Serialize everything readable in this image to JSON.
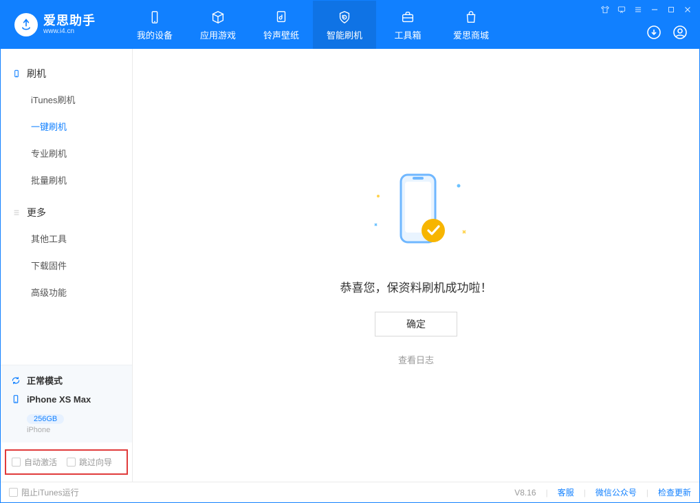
{
  "header": {
    "app_title": "爱思助手",
    "app_subtitle": "www.i4.cn",
    "nav": [
      "我的设备",
      "应用游戏",
      "铃声壁纸",
      "智能刷机",
      "工具箱",
      "爱思商城"
    ]
  },
  "sidebar": {
    "group1": {
      "label": "刷机",
      "items": [
        "iTunes刷机",
        "一键刷机",
        "专业刷机",
        "批量刷机"
      ]
    },
    "group2": {
      "label": "更多",
      "items": [
        "其他工具",
        "下载固件",
        "高级功能"
      ]
    }
  },
  "device": {
    "mode": "正常模式",
    "name": "iPhone XS Max",
    "storage": "256GB",
    "type": "iPhone"
  },
  "options": {
    "auto_activate": "自动激活",
    "skip_guide": "跳过向导"
  },
  "main": {
    "message": "恭喜您，保资料刷机成功啦！",
    "ok_button": "确定",
    "view_log": "查看日志"
  },
  "footer": {
    "block_itunes": "阻止iTunes运行",
    "version": "V8.16",
    "links": [
      "客服",
      "微信公众号",
      "检查更新"
    ]
  }
}
